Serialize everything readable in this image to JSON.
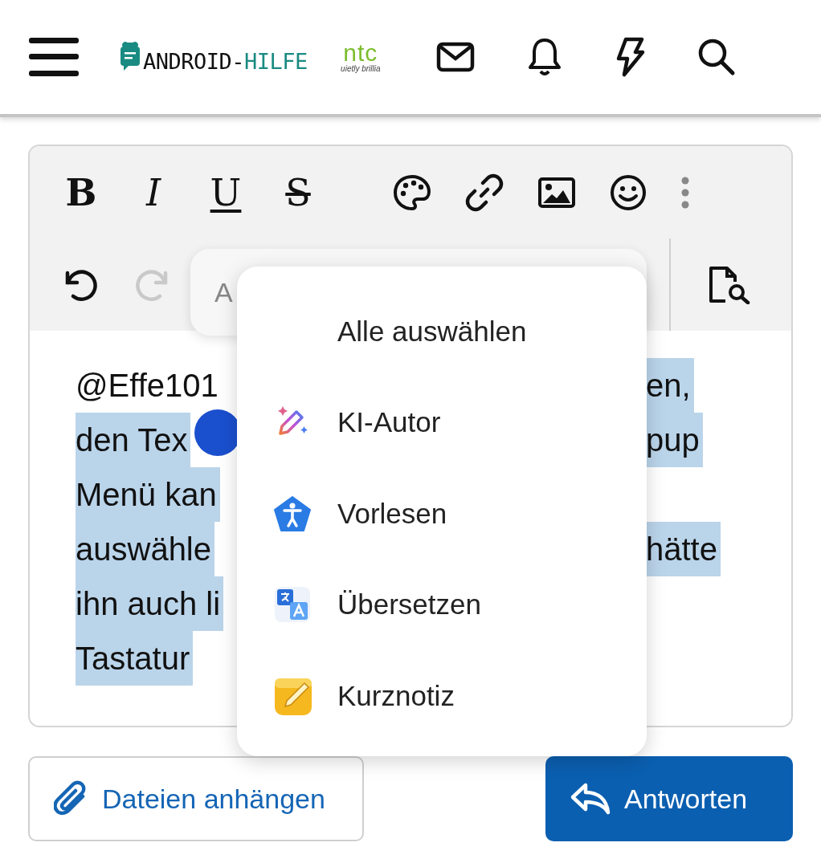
{
  "header": {
    "logo": {
      "first": "ANDROID-",
      "second": "HILFE"
    },
    "partner_logo": {
      "mark": "ntc",
      "tagline": "uietly brillia"
    }
  },
  "editor": {
    "format_buttons": [
      {
        "label": "B",
        "kind": "bold"
      },
      {
        "label": "I",
        "kind": "italic"
      },
      {
        "label": "U",
        "kind": "underline"
      },
      {
        "label": "S",
        "kind": "strike"
      }
    ],
    "undo": {
      "disabled": false
    },
    "redo": {
      "disabled": true
    },
    "lines": [
      {
        "left": {
          "text": "@Effe101",
          "selected": false
        },
        "right": {
          "text": "en,",
          "selected": true
        }
      },
      {
        "left": {
          "text": "den Tex",
          "selected": true
        },
        "right": {
          "text": "pup",
          "selected": true
        }
      },
      {
        "left": {
          "text": "Menü kan",
          "selected": true
        }
      },
      {
        "left": {
          "text": "auswähle",
          "selected": true
        },
        "right": {
          "text": "hätte",
          "selected": true
        }
      },
      {
        "left": {
          "text": "ihn auch li",
          "selected": true
        }
      },
      {
        "left": {
          "text": "Tastatur",
          "selected": true
        }
      }
    ]
  },
  "toolbar_popup": {
    "text": "A"
  },
  "context_menu": {
    "items": [
      {
        "label": "Alle auswählen"
      },
      {
        "label": "KI-Autor"
      },
      {
        "label": "Vorlesen"
      },
      {
        "label": "Übersetzen"
      },
      {
        "label": "Kurznotiz"
      }
    ]
  },
  "buttons": [
    {
      "label": "Dateien anhängen",
      "kind": "secondary"
    },
    {
      "label": "Antworten",
      "kind": "primary"
    }
  ]
}
